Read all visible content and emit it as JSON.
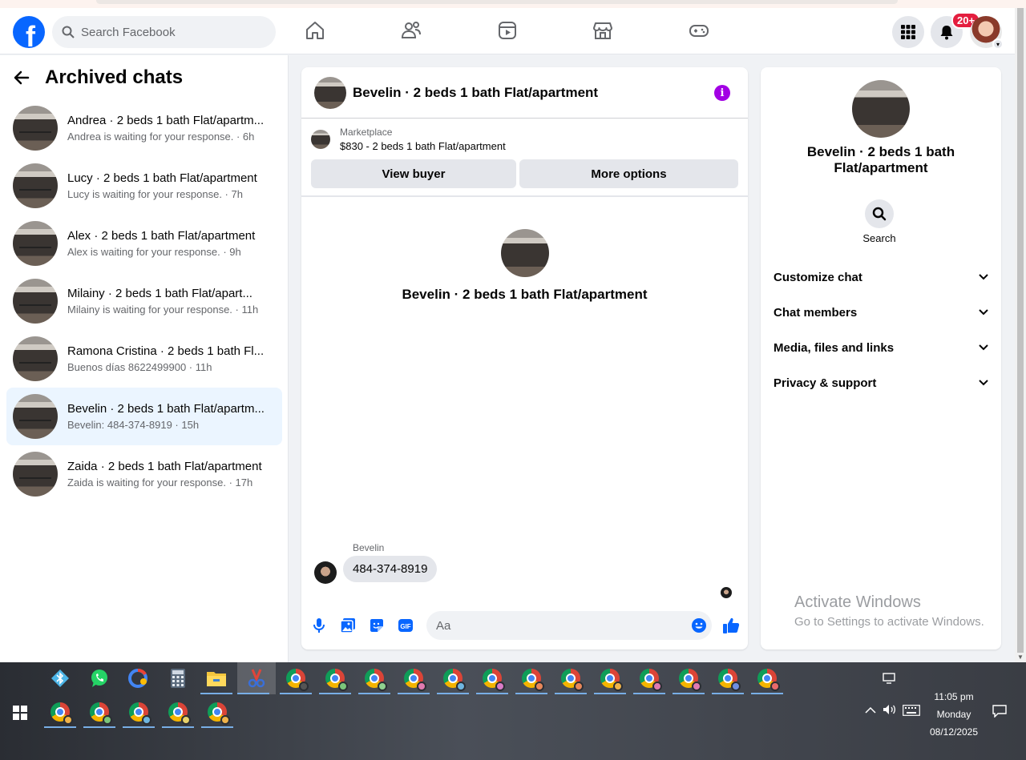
{
  "header": {
    "logo": "f",
    "search_placeholder": "Search Facebook",
    "nav_icons": [
      "home-icon",
      "friends-icon",
      "video-icon",
      "marketplace-icon",
      "gaming-icon"
    ],
    "notifications_badge": "20+"
  },
  "sidebar": {
    "title": "Archived chats",
    "chats": [
      {
        "name": "Andrea · 2 beds 1 bath Flat/apartm...",
        "subtitle": "Andrea is waiting for your response. · 6h"
      },
      {
        "name": "Lucy · 2 beds 1 bath Flat/apartment",
        "subtitle": "Lucy is waiting for your response. · 7h"
      },
      {
        "name": "Alex · 2 beds 1 bath Flat/apartment",
        "subtitle": "Alex is waiting for your response. · 9h"
      },
      {
        "name": "Milainy · 2 beds 1 bath Flat/apart...",
        "subtitle": "Milainy is waiting for your response. · 11h"
      },
      {
        "name": "Ramona Cristina · 2 beds 1 bath Fl...",
        "subtitle": "Buenos días 8622499900 · 11h"
      },
      {
        "name": "Bevelin · 2 beds 1 bath Flat/apartm...",
        "subtitle": "Bevelin: 484-374-8919 · 15h"
      },
      {
        "name": "Zaida · 2 beds 1 bath Flat/apartment",
        "subtitle": "Zaida is waiting for your response. · 17h"
      }
    ],
    "active_index": 5
  },
  "conversation": {
    "title": "Bevelin · 2 beds 1 bath Flat/apartment",
    "marketplace_label": "Marketplace",
    "listing": "$830 - 2 beds 1 bath Flat/apartment",
    "view_buyer": "View buyer",
    "more_options": "More options",
    "profile_name": "Bevelin · 2 beds 1 bath Flat/apartment",
    "sender": "Bevelin",
    "message": "484-374-8919",
    "input_placeholder": "Aa"
  },
  "details": {
    "name": "Bevelin · 2 beds 1 bath Flat/apartment",
    "search_label": "Search",
    "sections": [
      "Customize chat",
      "Chat members",
      "Media, files and links",
      "Privacy & support"
    ]
  },
  "watermark": {
    "line1": "Activate Windows",
    "line2": "Go to Settings to activate Windows."
  },
  "taskbar": {
    "time": "11:05 pm",
    "day": "Monday",
    "date": "08/12/2025"
  },
  "colors": {
    "brand": "#0866ff",
    "active_row": "#ebf5ff",
    "info": "#a200e4",
    "badge": "#e41e3f"
  }
}
